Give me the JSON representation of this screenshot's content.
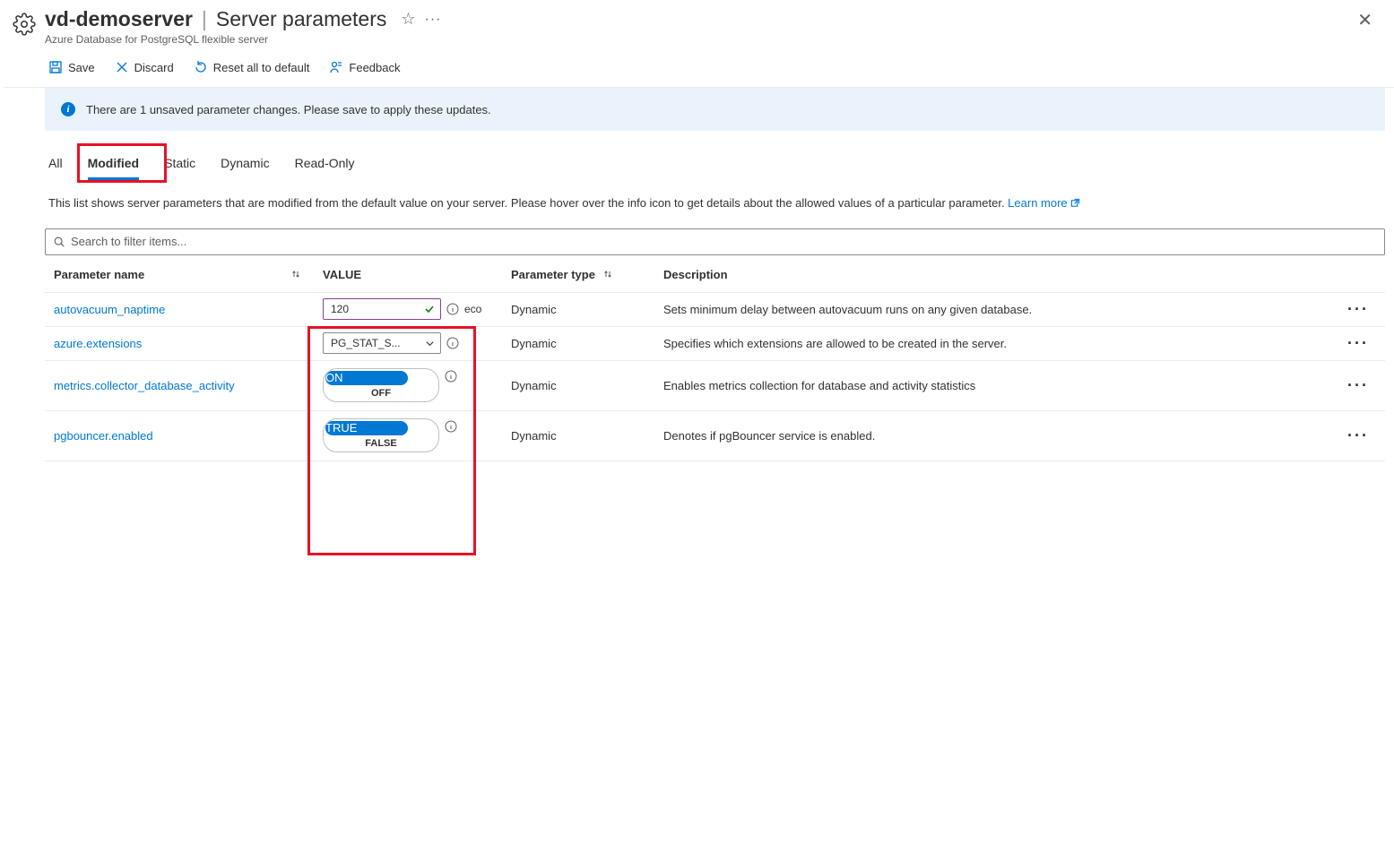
{
  "header": {
    "server_name": "vd-demoserver",
    "page_title": "Server parameters",
    "subtitle": "Azure Database for PostgreSQL flexible server"
  },
  "toolbar": {
    "save": "Save",
    "discard": "Discard",
    "reset": "Reset all to default",
    "feedback": "Feedback"
  },
  "banner": {
    "text": "There are 1 unsaved parameter changes.  Please save to apply these updates."
  },
  "tabs": {
    "all": "All",
    "modified": "Modified",
    "static": "Static",
    "dynamic": "Dynamic",
    "readonly": "Read-Only"
  },
  "description": {
    "text": "This list shows server parameters that are modified from the default value on your server. Please hover over the info icon to get details about the allowed values of a particular parameter. ",
    "link": "Learn more"
  },
  "search": {
    "placeholder": "Search to filter items..."
  },
  "columns": {
    "name": "Parameter name",
    "value": "VALUE",
    "type": "Parameter type",
    "desc": "Description"
  },
  "rows": [
    {
      "name": "autovacuum_naptime",
      "value_kind": "text",
      "value": "120",
      "extra": "eco",
      "type": "Dynamic",
      "desc": "Sets minimum delay between autovacuum runs on any given database."
    },
    {
      "name": "azure.extensions",
      "value_kind": "dropdown",
      "value": "PG_STAT_S...",
      "type": "Dynamic",
      "desc": "Specifies which extensions are allowed to be created in the server."
    },
    {
      "name": "metrics.collector_database_activity",
      "value_kind": "toggle",
      "on": "ON",
      "off": "OFF",
      "type": "Dynamic",
      "desc": "Enables metrics collection for database and activity statistics"
    },
    {
      "name": "pgbouncer.enabled",
      "value_kind": "toggle",
      "on": "TRUE",
      "off": "FALSE",
      "type": "Dynamic",
      "desc": "Denotes if pgBouncer service is enabled."
    }
  ]
}
